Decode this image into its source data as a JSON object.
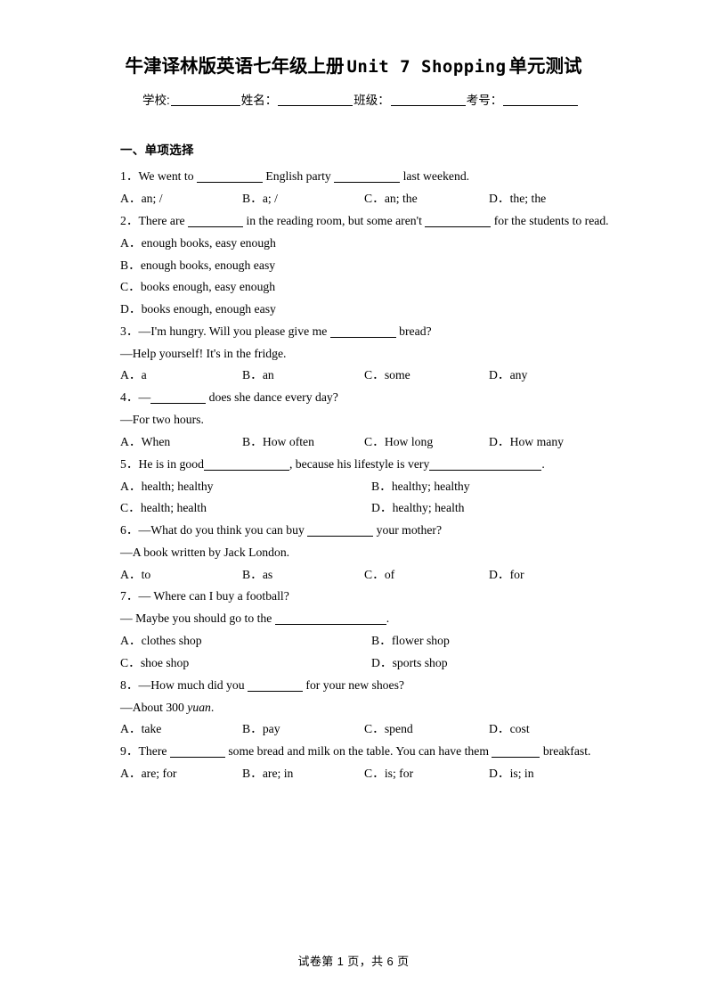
{
  "title": {
    "prefix": "牛津译林版英语七年级上册",
    "mono": "Unit 7 Shopping",
    "suffix": "单元测试"
  },
  "exam_info": {
    "school_label": "学校:",
    "name_label": "姓名：",
    "class_label": "班级：",
    "exam_no_label": "考号："
  },
  "section": {
    "heading": "一、单项选择"
  },
  "questions": [
    {
      "num": "1．",
      "stem_pre": "We went to ",
      "stem_mid": " English party ",
      "stem_post": " last weekend.",
      "options": [
        "A．an; /",
        "B．a; /",
        "C．an; the",
        "D．the; the"
      ]
    },
    {
      "num": "2．",
      "stem_pre": "There are ",
      "stem_mid": " in the reading room, but some aren't ",
      "stem_post": " for the students to read.",
      "options": [
        "A．enough books, easy enough",
        "B．enough books, enough easy",
        "C．books enough, easy enough",
        "D．books enough, enough easy"
      ]
    },
    {
      "num": "3．",
      "stem_pre": "—I'm hungry. Will you please give me ",
      "stem_post": " bread?",
      "answer_line": "—Help yourself! It's in the fridge.",
      "options": [
        "A．a",
        "B．an",
        "C．some",
        "D．any"
      ]
    },
    {
      "num": "4．",
      "stem_pre": "—",
      "stem_post": " does she dance every day?",
      "answer_line": "—For two hours.",
      "options": [
        "A．When",
        "B．How often",
        "C．How long",
        "D．How many"
      ]
    },
    {
      "num": "5．",
      "stem_pre": "He is in good",
      "stem_mid": ", because his lifestyle is very",
      "stem_post": ".",
      "options": [
        "A．health; healthy",
        "B．healthy; healthy",
        "C．health; health",
        "D．healthy; health"
      ]
    },
    {
      "num": "6．",
      "stem_pre": "—What do you think you can buy ",
      "stem_post": " your mother?",
      "answer_line": "—A book written by Jack London.",
      "options": [
        "A．to",
        "B．as",
        "C．of",
        "D．for"
      ]
    },
    {
      "num": "7．",
      "stem_pre": "— Where can I buy a football?",
      "answer_line_pre": "— Maybe you should go to the ",
      "answer_line_post": ".",
      "options": [
        "A．clothes shop",
        "B．flower shop",
        "C．shoe shop",
        "D．sports shop"
      ]
    },
    {
      "num": "8．",
      "stem_pre": "—How much did you ",
      "stem_post": " for your new shoes?",
      "answer_line_pre": "—About 300 ",
      "answer_line_italic": "yuan",
      "answer_line_post": ".",
      "options": [
        "A．take",
        "B．pay",
        "C．spend",
        "D．cost"
      ]
    },
    {
      "num": "9．",
      "stem_pre": "There ",
      "stem_mid": " some bread and milk on the table. You can have them ",
      "stem_post": " breakfast.",
      "options": [
        "A．are; for",
        "B．are; in",
        "C．is; for",
        "D．is; in"
      ]
    }
  ],
  "footer": {
    "text": "试卷第 1 页，共 6 页"
  }
}
